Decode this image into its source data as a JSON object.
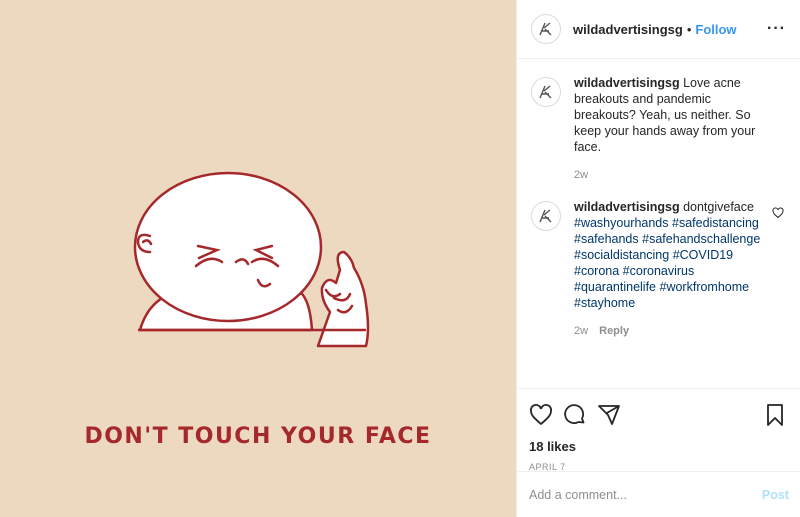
{
  "media": {
    "caption": "DON'T TOUCH YOUR FACE"
  },
  "header": {
    "username": "wildadvertisingsg",
    "separator": "•",
    "follow_label": "Follow",
    "more_label": "···"
  },
  "caption_comment": {
    "username": "wildadvertisingsg",
    "text": "Love acne breakouts and pandemic breakouts? Yeah, us neither. So keep your hands away from your face.",
    "time": "2w"
  },
  "hashtag_comment": {
    "username": "wildadvertisingsg",
    "text": "dontgiveface",
    "hashtags": [
      "#washyourhands",
      "#safedistancing",
      "#safehands",
      "#safehandschallenge",
      "#socialdistancing",
      "#COVID19",
      "#corona",
      "#coronavirus",
      "#quarantinelife",
      "#workfromhome",
      "#stayhome"
    ],
    "time": "2w",
    "reply_label": "Reply"
  },
  "actions": {
    "icons": [
      "heart-icon",
      "comment-icon",
      "share-icon",
      "bookmark-icon"
    ]
  },
  "likes": "18 likes",
  "date": "APRIL 7",
  "comment_box": {
    "placeholder": "Add a comment...",
    "post_label": "Post"
  },
  "colors": {
    "media_bg": "#ecd9c0",
    "caption": "#a5282b",
    "link": "#3897f0",
    "hashtag": "#00376b"
  }
}
